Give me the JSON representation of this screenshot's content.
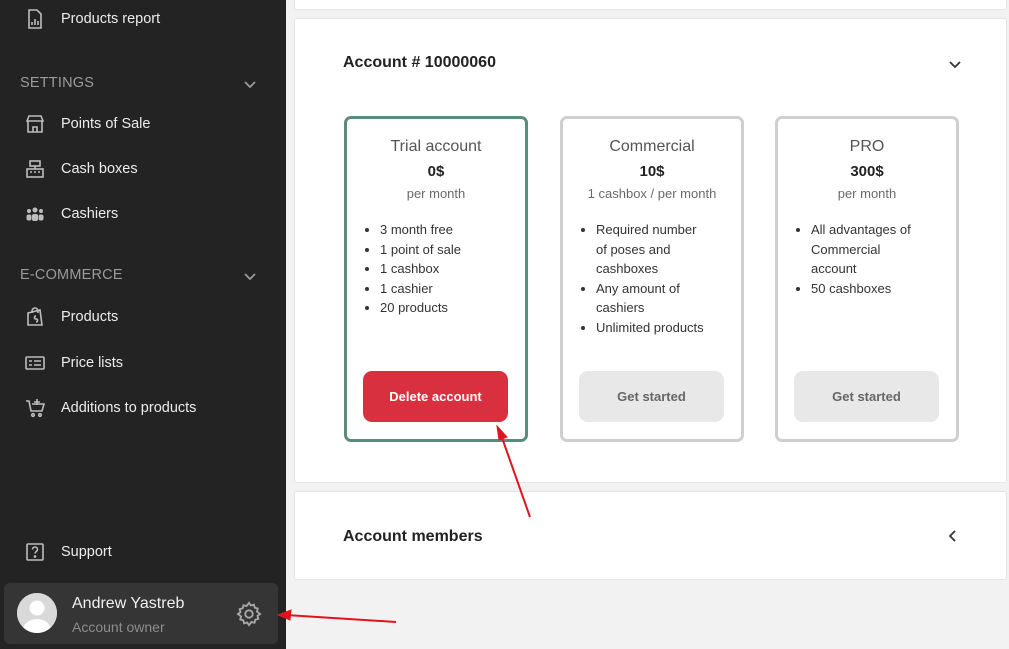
{
  "sidebar": {
    "top_item": {
      "label": "Products report",
      "icon": "report-icon"
    },
    "settings": {
      "title": "SETTINGS",
      "items": [
        {
          "label": "Points of Sale",
          "icon": "store-icon"
        },
        {
          "label": "Cash boxes",
          "icon": "cash-register-icon"
        },
        {
          "label": "Cashiers",
          "icon": "people-icon"
        }
      ]
    },
    "ecommerce": {
      "title": "E-COMMERCE",
      "items": [
        {
          "label": "Products",
          "icon": "shopping-bag-icon"
        },
        {
          "label": "Price lists",
          "icon": "price-list-icon"
        },
        {
          "label": "Additions to products",
          "icon": "cart-plus-icon"
        }
      ]
    },
    "support": {
      "label": "Support",
      "icon": "help-icon"
    },
    "user": {
      "name": "Andrew Yastreb",
      "role": "Account owner"
    }
  },
  "account": {
    "title": "Account # 10000060",
    "plans": [
      {
        "name": "Trial account",
        "price": "0$",
        "period": "per month",
        "features": [
          "3 month free",
          "1 point of sale",
          "1 cashbox",
          "1 cashier",
          "20 products"
        ],
        "button": "Delete account"
      },
      {
        "name": "Commercial",
        "price": "10$",
        "period": "1 cashbox / per month",
        "features": [
          "Required number of poses and cashboxes",
          "Any amount of cashiers",
          "Unlimited products"
        ],
        "button": "Get started"
      },
      {
        "name": "PRO",
        "price": "300$",
        "period": "per month",
        "features": [
          "All advantages of Commercial account",
          "50 cashboxes"
        ],
        "button": "Get started"
      }
    ]
  },
  "members": {
    "title": "Account members"
  },
  "colors": {
    "sidebar_bg": "#232323",
    "active_plan_border": "#5b8c7b",
    "danger": "#d93040",
    "annotation_arrow": "#e0141e"
  }
}
